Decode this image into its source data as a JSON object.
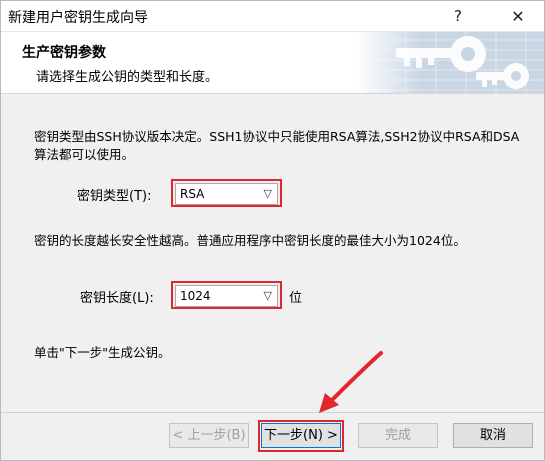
{
  "window": {
    "title": "新建用户密钥生成向导",
    "help_glyph": "?",
    "close_glyph": "✕"
  },
  "header": {
    "title": "生产密钥参数",
    "subtitle": "请选择生成公钥的类型和长度。"
  },
  "content": {
    "para1": "密钥类型由SSH协议版本决定。SSH1协议中只能使用RSA算法,SSH2协议中RSA和DSA算法都可以使用。",
    "key_type_label": "密钥类型(T):",
    "key_type_value": "RSA",
    "para2": "密钥的长度越长安全性越高。普通应用程序中密钥长度的最佳大小为1024位。",
    "key_length_label": "密钥长度(L):",
    "key_length_value": "1024",
    "key_length_unit": "位",
    "para3": "单击\"下一步\"生成公钥。"
  },
  "buttons": {
    "back": "< 上一步(B)",
    "next": "下一步(N) >",
    "finish": "完成",
    "cancel": "取消"
  },
  "colors": {
    "highlight": "#e2262e",
    "window_bg": "#f0f0f0",
    "header_art": "#9fb8cf"
  }
}
